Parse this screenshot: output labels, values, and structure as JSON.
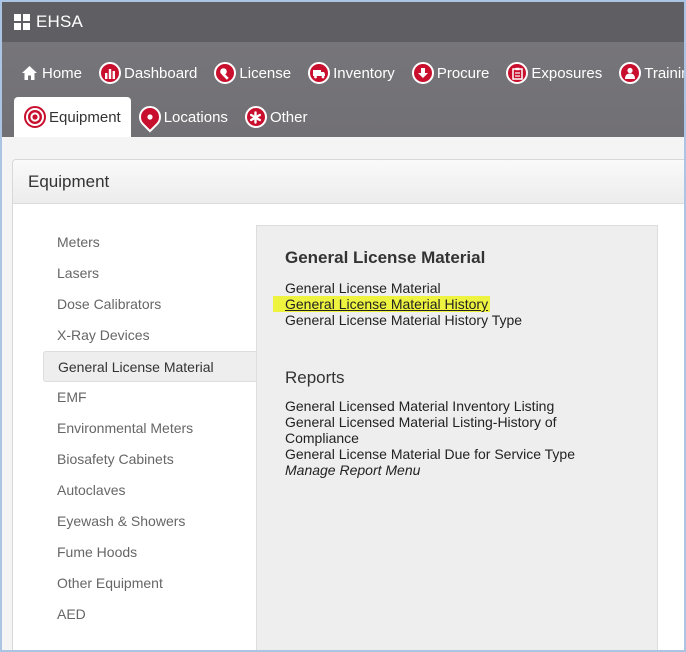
{
  "app": {
    "title": "EHSA"
  },
  "nav": {
    "row1": [
      {
        "label": "Home",
        "icon": "home-icon"
      },
      {
        "label": "Dashboard",
        "icon": "bar-chart-icon"
      },
      {
        "label": "License",
        "icon": "wrench-icon"
      },
      {
        "label": "Inventory",
        "icon": "truck-icon"
      },
      {
        "label": "Procure",
        "icon": "arrow-down-icon"
      },
      {
        "label": "Exposures",
        "icon": "clipboard-icon"
      },
      {
        "label": "Training",
        "icon": "person-icon"
      }
    ],
    "row2": [
      {
        "label": "Equipment",
        "icon": "target-icon",
        "active": true
      },
      {
        "label": "Locations",
        "icon": "map-pin-icon"
      },
      {
        "label": "Other",
        "icon": "asterisk-icon"
      }
    ]
  },
  "panel": {
    "title": "Equipment"
  },
  "sidebar": {
    "items": [
      {
        "label": "Meters"
      },
      {
        "label": "Lasers"
      },
      {
        "label": "Dose Calibrators"
      },
      {
        "label": "X-Ray Devices"
      },
      {
        "label": "General License Material",
        "active": true
      },
      {
        "label": "EMF"
      },
      {
        "label": "Environmental Meters"
      },
      {
        "label": "Biosafety Cabinets"
      },
      {
        "label": "Autoclaves"
      },
      {
        "label": "Eyewash & Showers"
      },
      {
        "label": "Fume Hoods"
      },
      {
        "label": "Other Equipment"
      },
      {
        "label": "AED"
      }
    ]
  },
  "main": {
    "section1": {
      "title": "General License Material",
      "links": [
        "General License Material",
        "General License Material History",
        "General License Material History Type"
      ]
    },
    "section2": {
      "title": "Reports",
      "links": [
        "General Licensed Material Inventory Listing",
        "General Licensed Material Listing-History of Compliance",
        "General License Material Due for Service Type",
        "Manage Report Menu"
      ]
    }
  },
  "colors": {
    "brand_red": "#c8102e",
    "nav_bg": "#727175",
    "highlight": "#eef33f"
  }
}
